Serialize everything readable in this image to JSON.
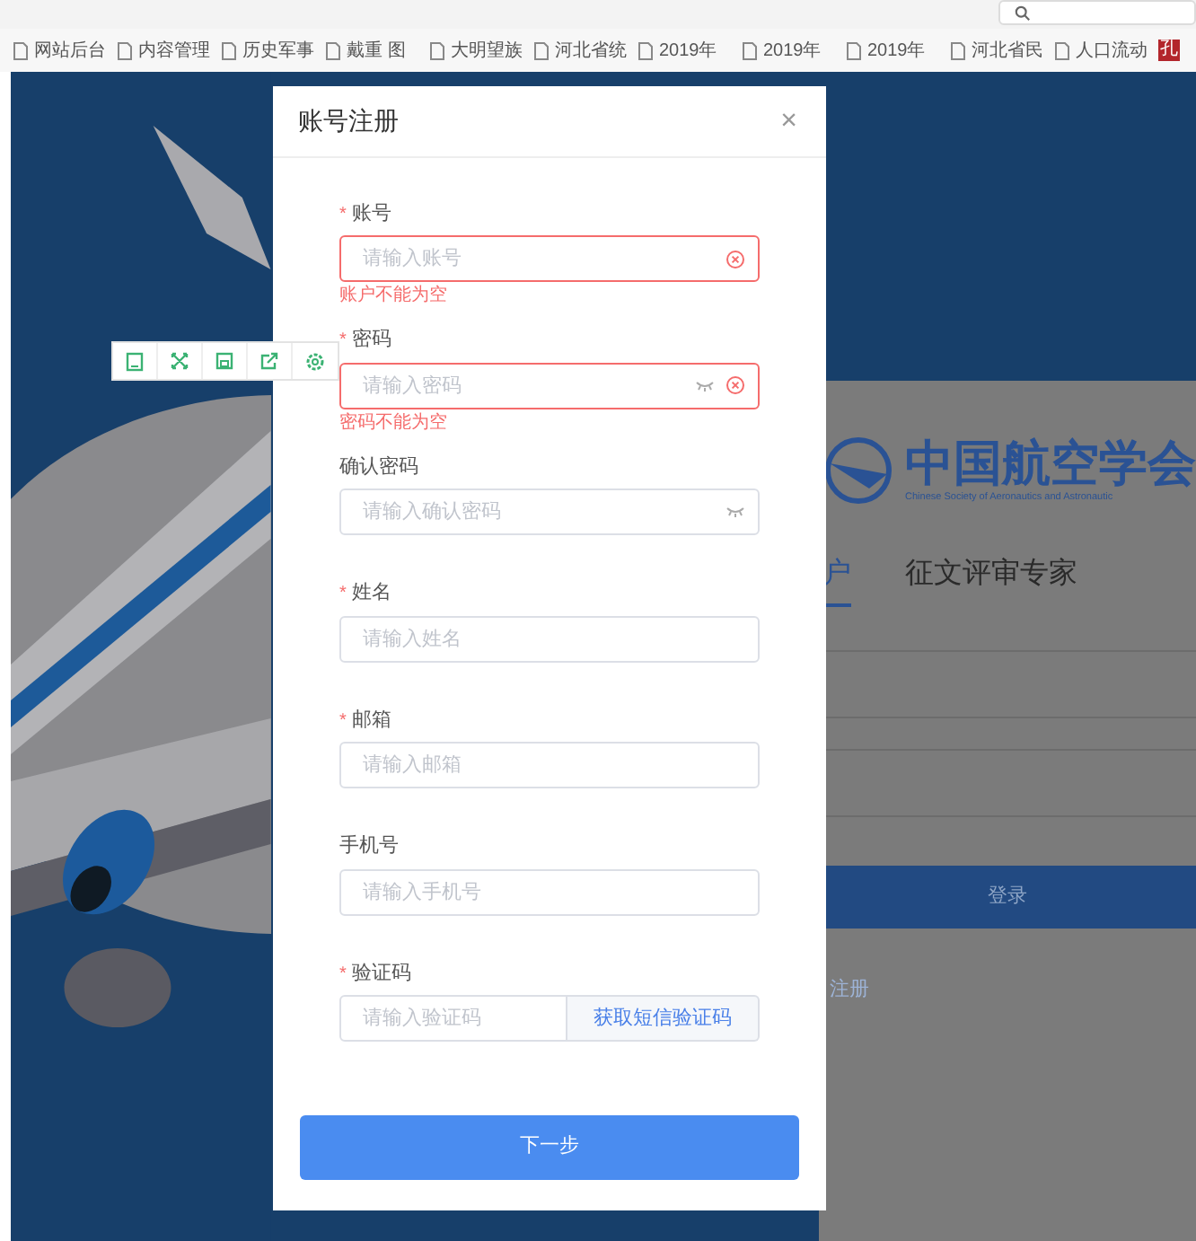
{
  "browser": {
    "bookmarks": [
      {
        "label": "网站后台"
      },
      {
        "label": "内容管理"
      },
      {
        "label": "历史军事"
      },
      {
        "label": "戴重 图"
      },
      {
        "label": "大明望族"
      },
      {
        "label": "河北省统"
      },
      {
        "label": "2019年"
      },
      {
        "label": "2019年"
      },
      {
        "label": "2019年"
      },
      {
        "label": "河北省民"
      },
      {
        "label": "人口流动"
      }
    ],
    "last_bookmark_icon": "孔"
  },
  "dialog": {
    "title": "账号注册",
    "close": "×",
    "fields": [
      {
        "kind": "text",
        "required_mark": "*",
        "label": "账号",
        "placeholder": "请输入账号",
        "error": "账户不能为空",
        "clear_button": true
      },
      {
        "kind": "password",
        "required_mark": "*",
        "label": "密码",
        "placeholder": "请输入密码",
        "error": "密码不能为空",
        "clear_button": true
      },
      {
        "kind": "password",
        "label": "确认密码",
        "placeholder": "请输入确认密码"
      },
      {
        "kind": "text",
        "required_mark": "*",
        "label": "姓名",
        "placeholder": "请输入姓名"
      },
      {
        "kind": "text",
        "required_mark": "*",
        "label": "邮箱",
        "placeholder": "请输入邮箱"
      },
      {
        "kind": "text",
        "label": "手机号",
        "placeholder": "请输入手机号"
      },
      {
        "kind": "sms",
        "required_mark": "*",
        "label": "验证码",
        "placeholder": "请输入验证码",
        "button": "获取短信验证码"
      }
    ],
    "submit": "下一步"
  },
  "background_page": {
    "logo_title": "中国航空学会",
    "logo_subtitle": "Chinese Society of Aeronautics and Astronautic",
    "tabs": [
      {
        "label": "户",
        "selected": true
      },
      {
        "label": "征文评审专家",
        "selected": false
      }
    ],
    "login_button": "登录",
    "register_link": "注册"
  }
}
